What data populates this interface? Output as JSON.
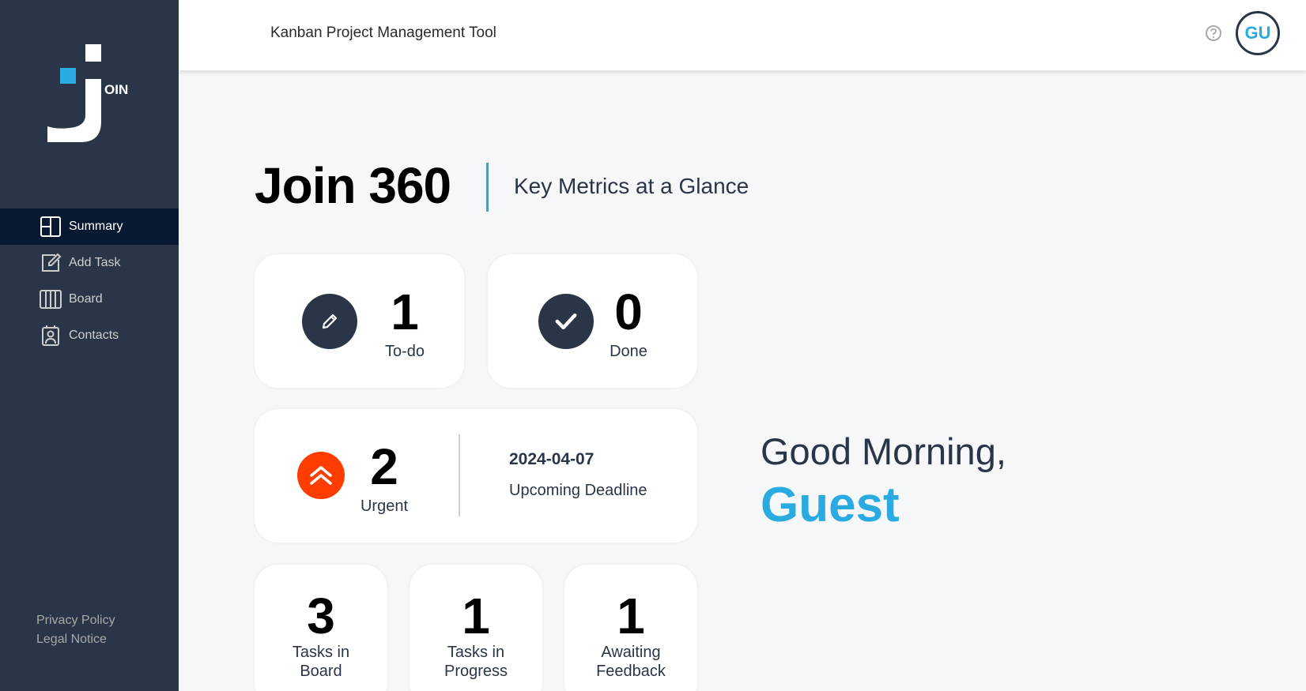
{
  "app": {
    "logo_text": "OIN",
    "header_title": "Kanban Project Management Tool",
    "user_initials": "GU"
  },
  "sidebar": {
    "items": [
      {
        "label": "Summary",
        "icon": "summary-icon",
        "active": true
      },
      {
        "label": "Add Task",
        "icon": "add-task-icon",
        "active": false
      },
      {
        "label": "Board",
        "icon": "board-icon",
        "active": false
      },
      {
        "label": "Contacts",
        "icon": "contacts-icon",
        "active": false
      }
    ],
    "footer": {
      "privacy": "Privacy Policy",
      "legal": "Legal Notice"
    }
  },
  "page": {
    "title": "Join 360",
    "subtitle": "Key Metrics at a Glance"
  },
  "metrics": {
    "todo": {
      "value": "1",
      "label": "To-do",
      "icon": "pencil-icon"
    },
    "done": {
      "value": "0",
      "label": "Done",
      "icon": "check-icon"
    },
    "urgent": {
      "value": "2",
      "label": "Urgent",
      "icon": "double-chevron-up-icon"
    },
    "deadline": {
      "date": "2024-04-07",
      "label": "Upcoming Deadline"
    },
    "board": {
      "value": "3",
      "label_line1": "Tasks in",
      "label_line2": "Board"
    },
    "progress": {
      "value": "1",
      "label_line1": "Tasks in",
      "label_line2": "Progress"
    },
    "feedback": {
      "value": "1",
      "label_line1": "Awaiting",
      "label_line2": "Feedback"
    }
  },
  "greeting": {
    "text": "Good Morning,",
    "name": "Guest"
  },
  "colors": {
    "sidebar": "#2a3647",
    "sidebar_active": "#091931",
    "accent": "#29abe2",
    "urgent": "#ff3d00",
    "background": "#f6f7f8"
  }
}
